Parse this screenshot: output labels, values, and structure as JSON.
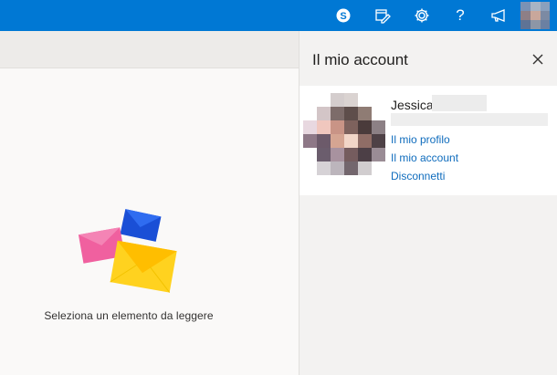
{
  "topbar": {
    "accent": "#0078d4",
    "icons": [
      "skype-icon",
      "edit-calendar-icon",
      "gear-icon",
      "help-icon",
      "megaphone-icon"
    ],
    "help_label": "?"
  },
  "reading_pane": {
    "empty_message": "Seleziona un elemento da leggere"
  },
  "account_panel": {
    "title": "Il mio account",
    "user_name": "Jessica",
    "links": {
      "profile": "Il mio profilo",
      "account": "Il mio account",
      "signout": "Disconnetti"
    },
    "link_color": "#0f6cbd"
  }
}
